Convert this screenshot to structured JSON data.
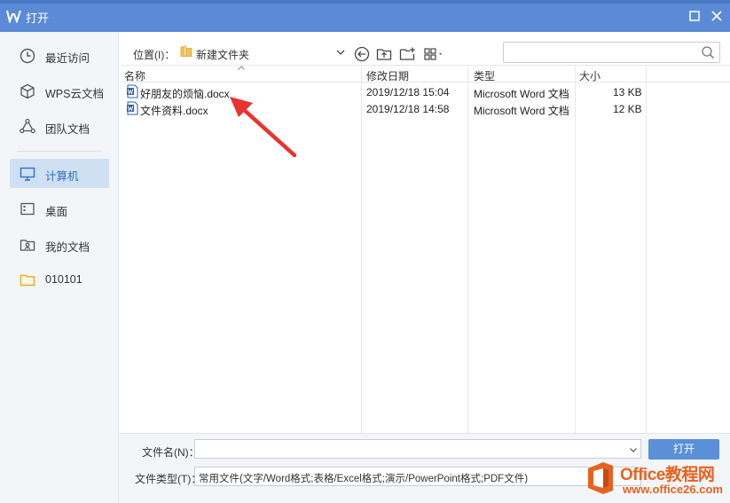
{
  "window": {
    "title": "打开"
  },
  "sidebar": {
    "items": [
      {
        "label": "最近访问",
        "icon": "clock-icon"
      },
      {
        "label": "WPS云文档",
        "icon": "cube-icon"
      },
      {
        "label": "团队文档",
        "icon": "team-icon"
      },
      {
        "label": "计算机",
        "icon": "computer-icon",
        "active": true
      },
      {
        "label": "桌面",
        "icon": "desktop-icon"
      },
      {
        "label": "我的文档",
        "icon": "my-documents-icon"
      },
      {
        "label": "010101",
        "icon": "folder-icon"
      }
    ]
  },
  "toolbar": {
    "location_label": "位置(I)：",
    "location_value": "新建文件夹",
    "search_placeholder": ""
  },
  "columns": {
    "name": "名称",
    "modified": "修改日期",
    "type": "类型",
    "size": "大小"
  },
  "files": [
    {
      "name": "好朋友的烦恼.docx",
      "modified": "2019/12/18 15:04",
      "type": "Microsoft Word 文档",
      "size": "13 KB"
    },
    {
      "name": "文件资料.docx",
      "modified": "2019/12/18 14:58",
      "type": "Microsoft Word 文档",
      "size": "12 KB"
    }
  ],
  "footer": {
    "filename_label": "文件名(N)：",
    "filename_value": "",
    "filetype_label": "文件类型(T)：",
    "filetype_value": "常用文件(文字/Word格式;表格/Excel格式;演示/PowerPoint格式;PDF文件)",
    "open_button": "打开"
  },
  "watermark": {
    "brand": "Office教程网",
    "url": "www.office26.com"
  },
  "colors": {
    "titlebar": "#5b8bd6",
    "accent": "#2d6fc2",
    "sidebar_bg": "#f3f5f8",
    "annotation": "#e8332f",
    "watermark": "#e8621f"
  }
}
